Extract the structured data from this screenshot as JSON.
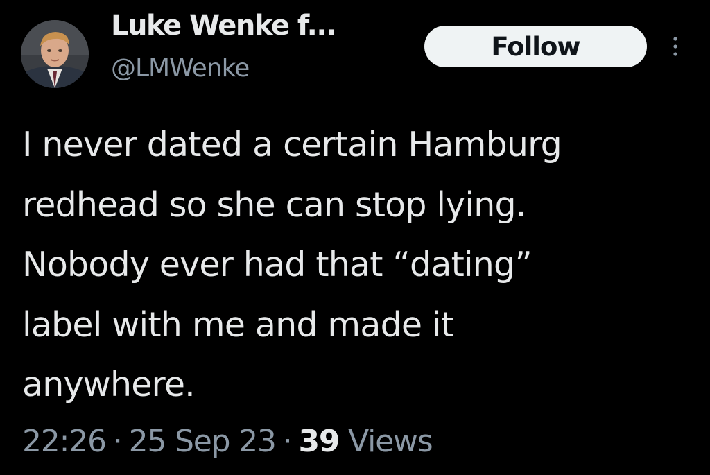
{
  "author": {
    "display_name": "Luke Wenke f...",
    "handle": "@LMWenke",
    "avatar_icon": "profile-photo"
  },
  "header": {
    "follow_label": "Follow",
    "more_icon": "more-vertical-icon"
  },
  "tweet": {
    "text": "I never dated a certain Hamburg\nredhead so she can stop lying.\nNobody ever had that “dating”\nlabel with me and made it\nanywhere."
  },
  "meta": {
    "time": "22:26",
    "separator": "·",
    "date": "25 Sep 23",
    "views_count": "39",
    "views_label": "Views"
  },
  "colors": {
    "background": "#000000",
    "primary_text": "#e7e9ea",
    "secondary_text": "#8b98a5",
    "follow_button_bg": "#eff3f4",
    "follow_button_text": "#0f1419"
  }
}
